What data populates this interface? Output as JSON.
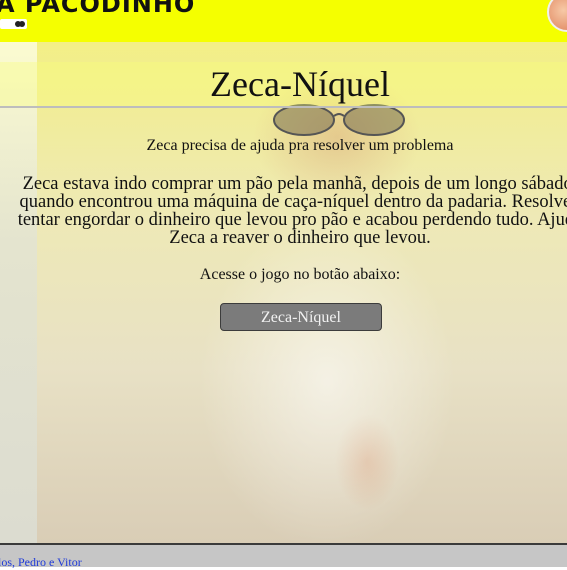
{
  "header": {
    "brand": "A PACODINHO",
    "colors": {
      "background": "#f5ff00"
    }
  },
  "main": {
    "title": "Zeca-Níquel",
    "subtitle": "Zeca precisa de ajuda pra resolver um problema",
    "description": "Zeca estava indo comprar um pão pela manhã, depois de um longo sábado, quando encontrou uma máquina de caça-níquel dentro da padaria. Resolveu tentar engordar o dinheiro que levou pro pão e acabou perdendo tudo. Ajude Zeca a reaver o dinheiro que levou.",
    "cta_text": "Acesse o jogo no botão abaixo:",
    "play_button_label": "Zeca-Níquel"
  },
  "footer": {
    "credits": "rlos, Pedro e Vitor"
  }
}
